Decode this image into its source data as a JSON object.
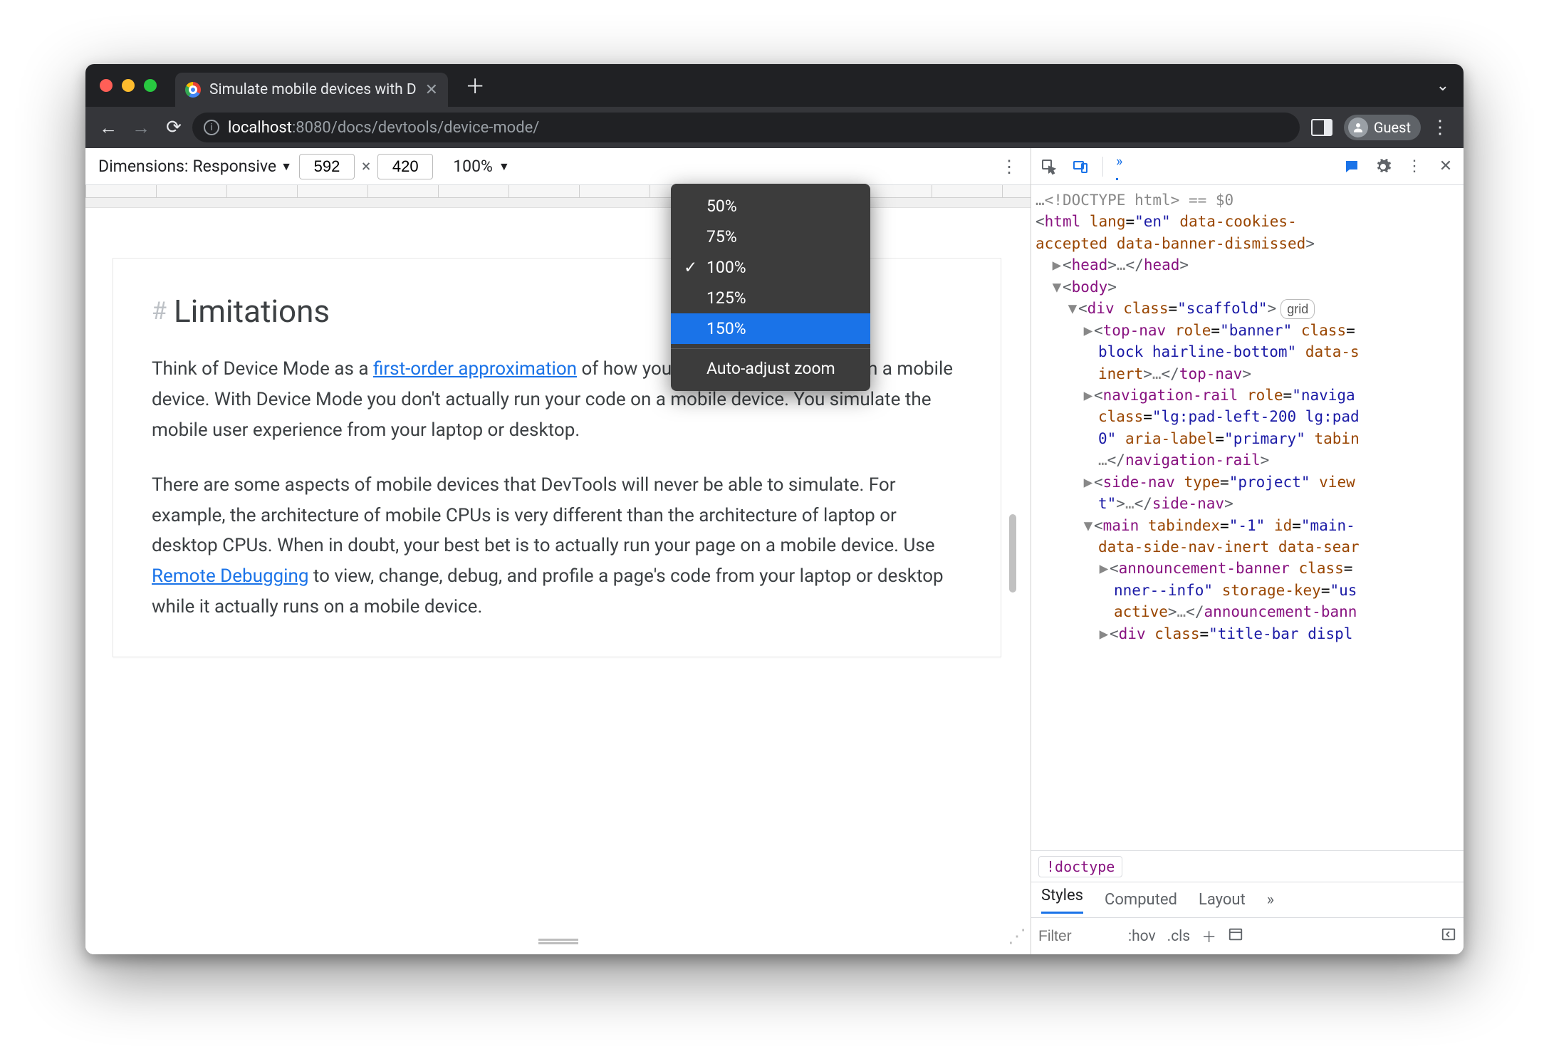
{
  "tab": {
    "title": "Simulate mobile devices with D"
  },
  "nav": {
    "url_host": "localhost",
    "url_port": ":8080",
    "url_path": "/docs/devtools/device-mode/",
    "guest_label": "Guest"
  },
  "device_toolbar": {
    "dimensions_label": "Dimensions:",
    "dimensions_mode": "Responsive",
    "width": "592",
    "height": "420",
    "zoom": "100%"
  },
  "zoom_menu": {
    "items": [
      {
        "label": "50%",
        "checked": false,
        "selected": false
      },
      {
        "label": "75%",
        "checked": false,
        "selected": false
      },
      {
        "label": "100%",
        "checked": true,
        "selected": false
      },
      {
        "label": "125%",
        "checked": false,
        "selected": false
      },
      {
        "label": "150%",
        "checked": false,
        "selected": true
      }
    ],
    "auto_label": "Auto-adjust zoom"
  },
  "page": {
    "heading": "Limitations",
    "para1_a": "Think of Device Mode as a ",
    "para1_link": "first-order approximation",
    "para1_b": " of how your page looks and feels on a mobile device. With Device Mode you don't actually run your code on a mobile device. You simulate the mobile user experience from your laptop or desktop.",
    "para2_a": "There are some aspects of mobile devices that DevTools will never be able to simulate. For example, the architecture of mobile CPUs is very different than the architecture of laptop or desktop CPUs. When in doubt, your best bet is to actually run your page on a mobile device. Use ",
    "para2_link": "Remote Debugging",
    "para2_b": " to view, change, debug, and profile a page's code from your laptop or desktop while it actually runs on a mobile device."
  },
  "devtools": {
    "doctype_line": "<!DOCTYPE html>",
    "eq_dollar": " == $0",
    "breadcrumb": "!doctype",
    "styles_tabs": [
      "Styles",
      "Computed",
      "Layout"
    ],
    "filter_placeholder": "Filter",
    "hov": ":hov",
    "cls": ".cls"
  }
}
